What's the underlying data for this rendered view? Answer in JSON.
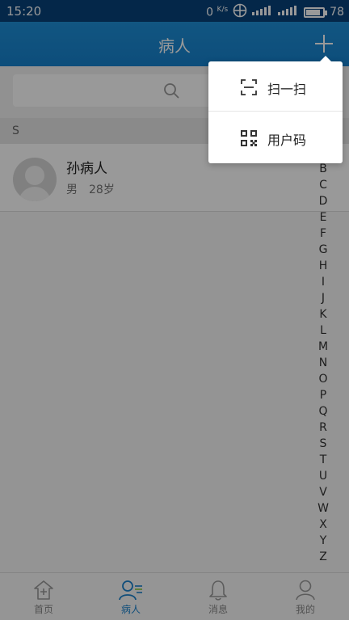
{
  "status_bar": {
    "time": "15:20",
    "net_speed": "0",
    "net_unit": "K/s",
    "battery": "78"
  },
  "header": {
    "title": "病人"
  },
  "section": {
    "letter": "S"
  },
  "patients": [
    {
      "name": "孙病人",
      "gender": "男",
      "age": "28岁"
    }
  ],
  "alphabet": [
    "B",
    "C",
    "D",
    "E",
    "F",
    "G",
    "H",
    "I",
    "J",
    "K",
    "L",
    "M",
    "N",
    "O",
    "P",
    "Q",
    "R",
    "S",
    "T",
    "U",
    "V",
    "W",
    "X",
    "Y",
    "Z"
  ],
  "menu": {
    "scan_label": "扫一扫",
    "code_label": "用户码"
  },
  "nav": {
    "home": "首页",
    "patients": "病人",
    "messages": "消息",
    "mine": "我的"
  },
  "colors": {
    "accent": "#1a80cc",
    "header": "#1681cd"
  }
}
